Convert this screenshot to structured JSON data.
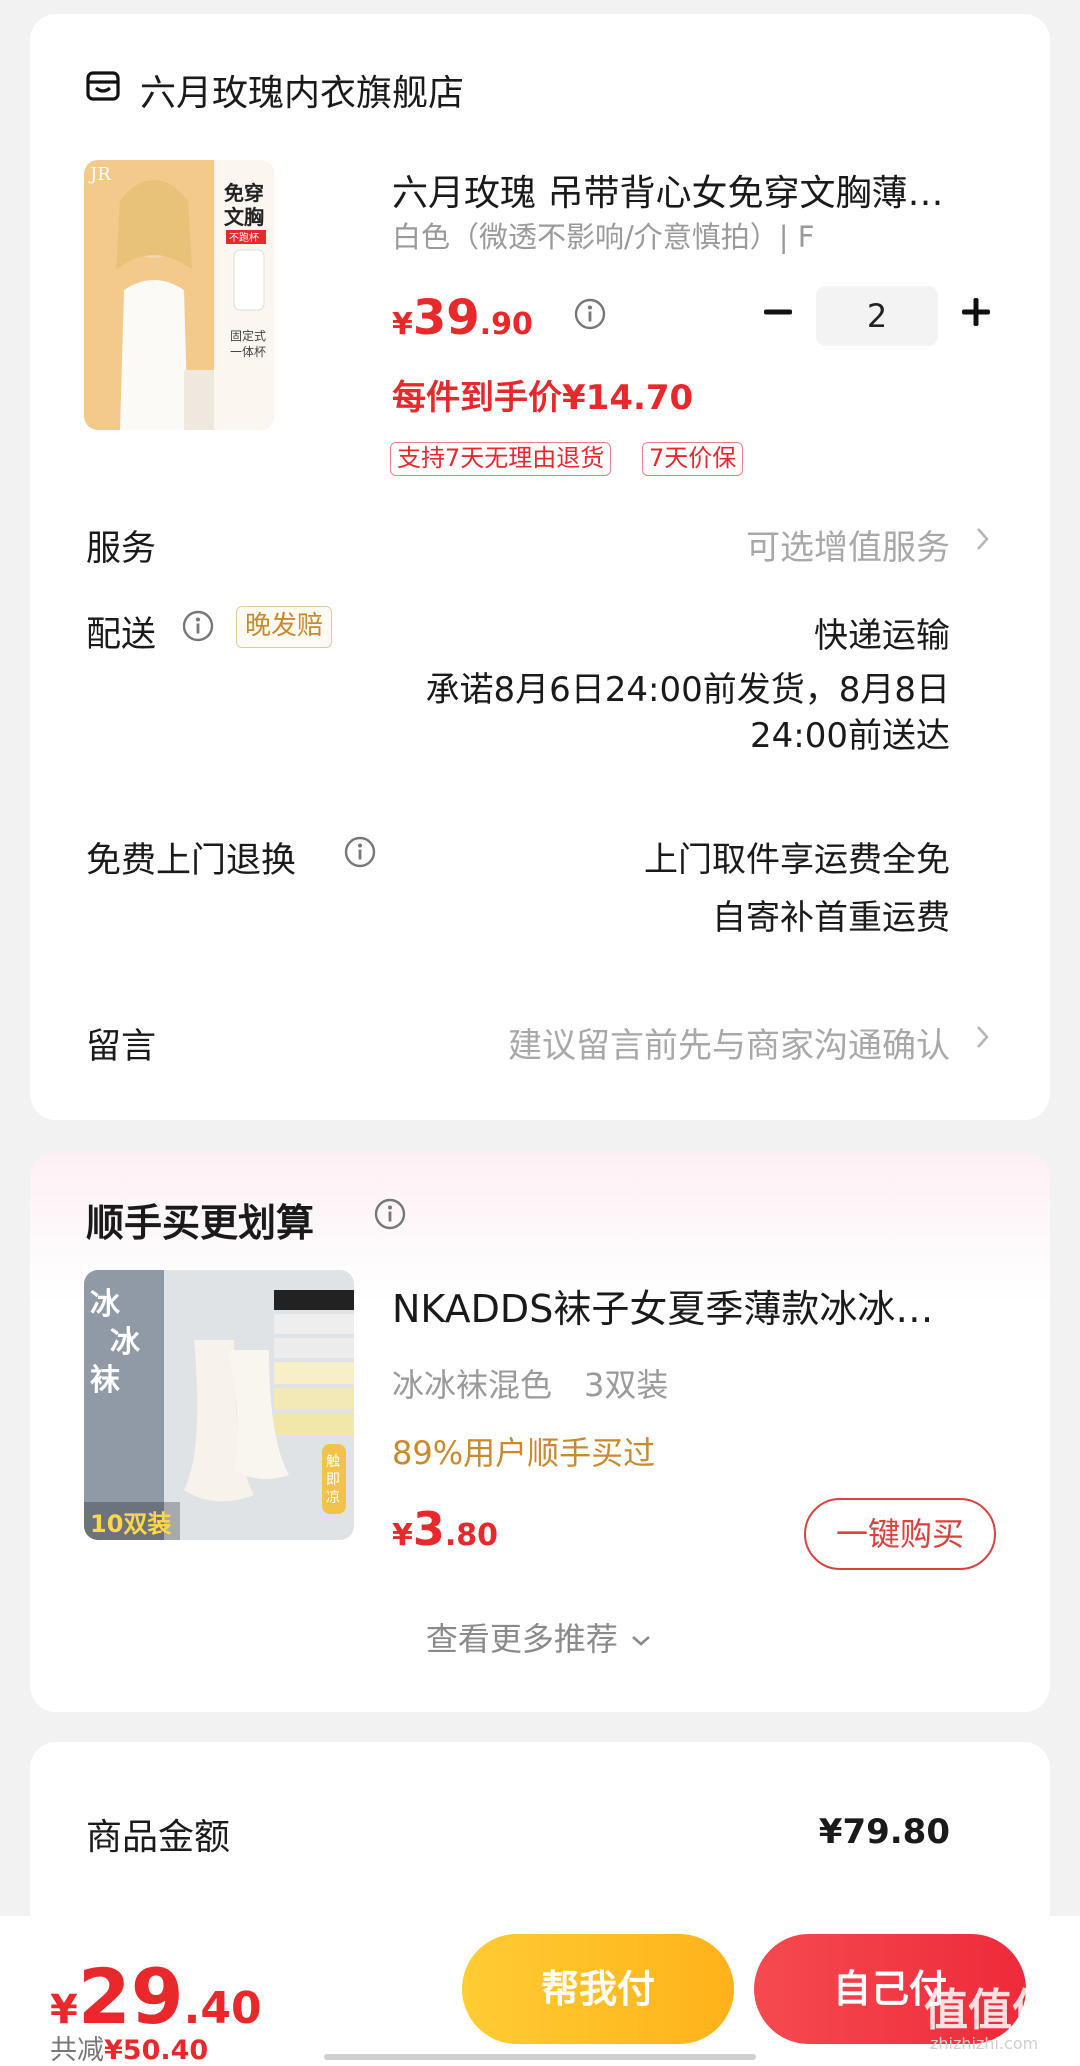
{
  "store": {
    "name": "六月玫瑰内衣旗舰店",
    "icon": "store-icon"
  },
  "product": {
    "title": "六月玫瑰 吊带背心女免穿文胸薄…",
    "spec": "白色（微透不影响/介意慎拍）| F",
    "price_symbol": "¥",
    "price_int": "39",
    "price_dec": ".90",
    "quantity": "2",
    "unit_price": "每件到手价¥14.70",
    "tags": [
      "支持7天无理由退货",
      "7天价保"
    ],
    "image_text": {
      "line1": "免穿",
      "line2": "文胸",
      "badge": "不跑杯",
      "note1": "固定式",
      "note2": "一体杯",
      "brand": "JR"
    }
  },
  "service": {
    "label": "服务",
    "value": "可选增值服务"
  },
  "delivery": {
    "label": "配送",
    "badge": "晚发赔",
    "method": "快递运输",
    "promise_line1": "承诺8月6日24:00前发货，8月8日",
    "promise_line2": "24:00前送达"
  },
  "free_return": {
    "label": "免费上门退换",
    "line1": "上门取件享运费全免",
    "line2": "自寄补首重运费"
  },
  "message": {
    "label": "留言",
    "placeholder": "建议留言前先与商家沟通确认"
  },
  "recommend": {
    "title": "顺手买更划算",
    "name": "NKADDS袜子女夏季薄款冰冰…",
    "spec": "冰冰袜混色　3双装",
    "social": "89%用户顺手买过",
    "price_symbol": "¥",
    "price_int": "3",
    "price_dec": ".80",
    "buy_label": "一键购买",
    "more_label": "查看更多推荐",
    "image_text": {
      "title": "冰冰袜",
      "pack": "10双装",
      "side": "触即凉"
    }
  },
  "amount": {
    "label": "商品金额",
    "value": "¥79.80"
  },
  "bottom": {
    "total_symbol": "¥",
    "total_int": "29",
    "total_dec": ".40",
    "discount_label": "共减",
    "discount_value": "¥50.40",
    "help_pay": "帮我付",
    "self_pay": "自己付",
    "watermark": "值值值",
    "watermark_sub": "zhizhizhi.com"
  },
  "colors": {
    "accent_red": "#e8282b",
    "gold": "#c98a2e",
    "yellow_btn": "#ffc02a",
    "red_btn": "#f03a45"
  }
}
